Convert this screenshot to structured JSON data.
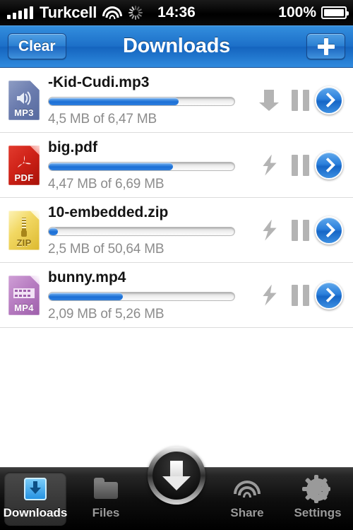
{
  "status_bar": {
    "carrier": "Turkcell",
    "time": "14:36",
    "battery_percent": "100%",
    "signal_icon": "signal-bars-icon",
    "wifi_icon": "wifi-icon",
    "activity_icon": "activity-spinner-icon",
    "battery_icon": "battery-icon"
  },
  "nav_bar": {
    "clear_label": "Clear",
    "title": "Downloads",
    "add_icon": "plus-icon"
  },
  "colors": {
    "nav_blue": "#1c6fc8",
    "progress_blue": "#1b6fd6",
    "accent_tab_blue": "#1f8fe0",
    "size_text_gray": "#8c8c8c"
  },
  "downloads": [
    {
      "filename": "-Kid-Cudi.mp3",
      "extension": "MP3",
      "icon": "mp3-file-icon",
      "glyph": "speaker-icon",
      "progress_percent": 70,
      "downloaded": "4,5 MB",
      "total": "6,47 MB",
      "size_text": "4,5 MB of 6,47 MB",
      "state_icon": "download-arrow-icon",
      "pause_icon": "pause-icon",
      "disclosure_icon": "chevron-right-icon"
    },
    {
      "filename": "big.pdf",
      "extension": "PDF",
      "icon": "pdf-file-icon",
      "glyph": "acrobat-a-icon",
      "progress_percent": 67,
      "downloaded": "4,47 MB",
      "total": "6,69 MB",
      "size_text": "4,47 MB of 6,69 MB",
      "state_icon": "lightning-bolt-icon",
      "pause_icon": "pause-icon",
      "disclosure_icon": "chevron-right-icon"
    },
    {
      "filename": "10-embedded.zip",
      "extension": "ZIP",
      "icon": "zip-file-icon",
      "glyph": "zipper-icon",
      "progress_percent": 5,
      "downloaded": "2,5 MB",
      "total": "50,64 MB",
      "size_text": "2,5 MB of 50,64 MB",
      "state_icon": "lightning-bolt-icon",
      "pause_icon": "pause-icon",
      "disclosure_icon": "chevron-right-icon"
    },
    {
      "filename": "bunny.mp4",
      "extension": "MP4",
      "icon": "mp4-file-icon",
      "glyph": "film-strip-icon",
      "progress_percent": 40,
      "downloaded": "2,09 MB",
      "total": "5,26 MB",
      "size_text": "2,09 MB of 5,26 MB",
      "state_icon": "lightning-bolt-icon",
      "pause_icon": "pause-icon",
      "disclosure_icon": "chevron-right-icon"
    }
  ],
  "tab_bar": {
    "items": [
      {
        "label": "Downloads",
        "icon": "inbox-download-icon",
        "active": true
      },
      {
        "label": "Files",
        "icon": "folder-icon",
        "active": false
      },
      {
        "label": "Share",
        "icon": "wifi-share-icon",
        "active": false
      },
      {
        "label": "Settings",
        "icon": "gear-icon",
        "active": false
      }
    ],
    "center_button_icon": "big-download-arrow-icon"
  }
}
